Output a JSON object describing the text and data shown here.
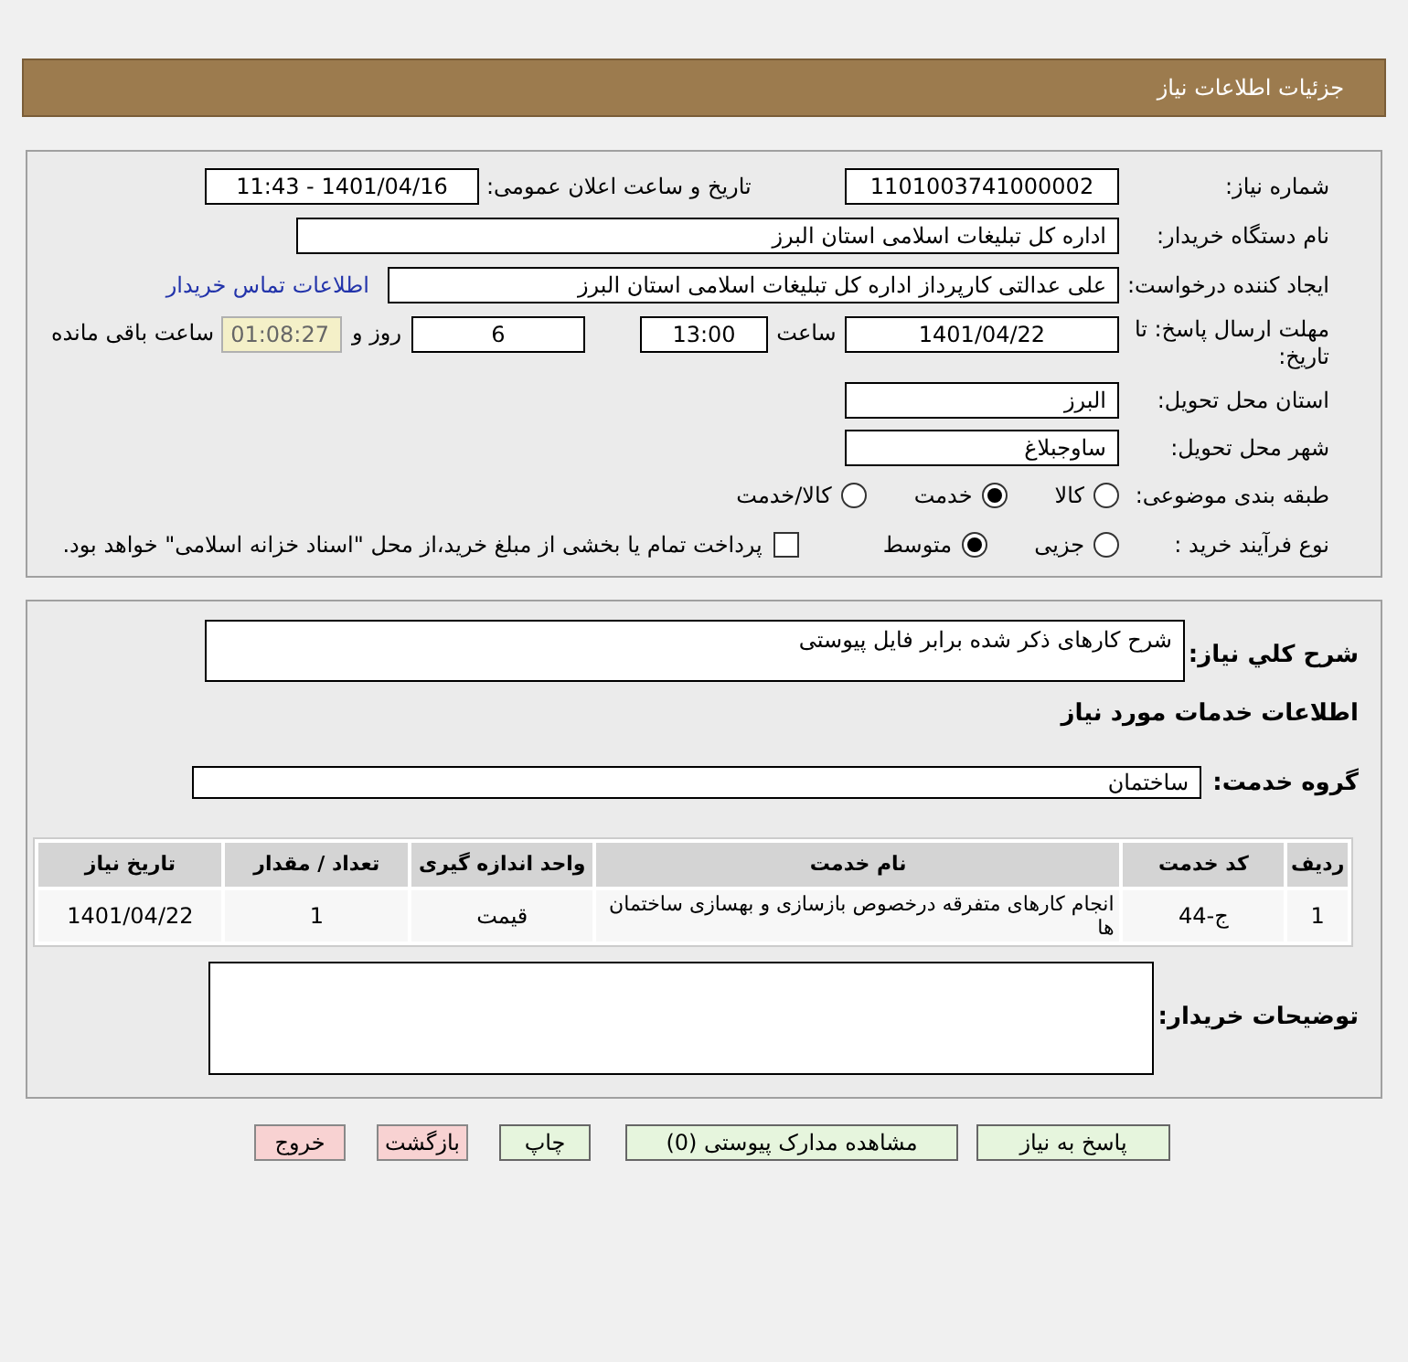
{
  "page_title": "جزئیات اطلاعات نیاز",
  "need_number": {
    "label": "شماره نیاز:",
    "value": "1101003741000002"
  },
  "announce": {
    "label": "تاریخ و ساعت اعلان عمومی:",
    "value": "1401/04/16 - 11:43"
  },
  "buyer_org": {
    "label": "نام دستگاه خریدار:",
    "value": "اداره کل تبلیغات اسلامی استان البرز"
  },
  "requester": {
    "label": "ایجاد کننده درخواست:",
    "value": "علی  عدالتی  کارپرداز  اداره کل تبلیغات اسلامی استان البرز",
    "contact_link": "اطلاعات تماس خریدار"
  },
  "deadline": {
    "label": "مهلت ارسال پاسخ: تا تاریخ:",
    "date": "1401/04/22",
    "time_label": "ساعت",
    "time": "13:00",
    "days": "6",
    "days_label": "روز و",
    "remaining": "01:08:27",
    "remaining_label": "ساعت باقی مانده"
  },
  "province": {
    "label": "استان محل تحویل:",
    "value": "البرز"
  },
  "city": {
    "label": "شهر محل تحویل:",
    "value": "ساوجبلاغ"
  },
  "category": {
    "label": "طبقه بندی موضوعی:",
    "options": [
      {
        "label": "کالا",
        "selected": false
      },
      {
        "label": "خدمت",
        "selected": true
      },
      {
        "label": "کالا/خدمت",
        "selected": false
      }
    ]
  },
  "process": {
    "label": "نوع فرآیند خرید :",
    "options": [
      {
        "label": "جزیی",
        "selected": false
      },
      {
        "label": "متوسط",
        "selected": true
      }
    ],
    "payment": {
      "checked": false,
      "text": "پرداخت تمام یا بخشی از مبلغ خرید،از محل \"اسناد خزانه اسلامی\" خواهد بود."
    }
  },
  "description": {
    "label": "شرح کلي نیاز:",
    "value": "شرح کارهای ذکر شده برابر فایل پیوستی"
  },
  "services_title": "اطلاعات خدمات مورد نیاز",
  "service_group": {
    "label": "گروه خدمت:",
    "value": "ساختمان"
  },
  "table": {
    "columns": [
      "ردیف",
      "کد خدمت",
      "نام خدمت",
      "واحد اندازه گیری",
      "تعداد / مقدار",
      "تاریخ نیاز"
    ],
    "rows": [
      [
        "1",
        "ج-44",
        "انجام کارهای متفرقه درخصوص بازسازی و بهسازی ساختمان ها",
        "قیمت",
        "1",
        "1401/04/22"
      ]
    ]
  },
  "buyer_notes": {
    "label": "توضیحات خریدار:"
  },
  "buttons": [
    {
      "label": "پاسخ به نیاز",
      "kind": "normal"
    },
    {
      "label": "مشاهده مدارک پیوستی (0)",
      "kind": "normal"
    },
    {
      "label": "چاپ",
      "kind": "normal"
    },
    {
      "label": "بازگشت",
      "kind": "danger"
    },
    {
      "label": "خروج",
      "kind": "danger"
    }
  ]
}
